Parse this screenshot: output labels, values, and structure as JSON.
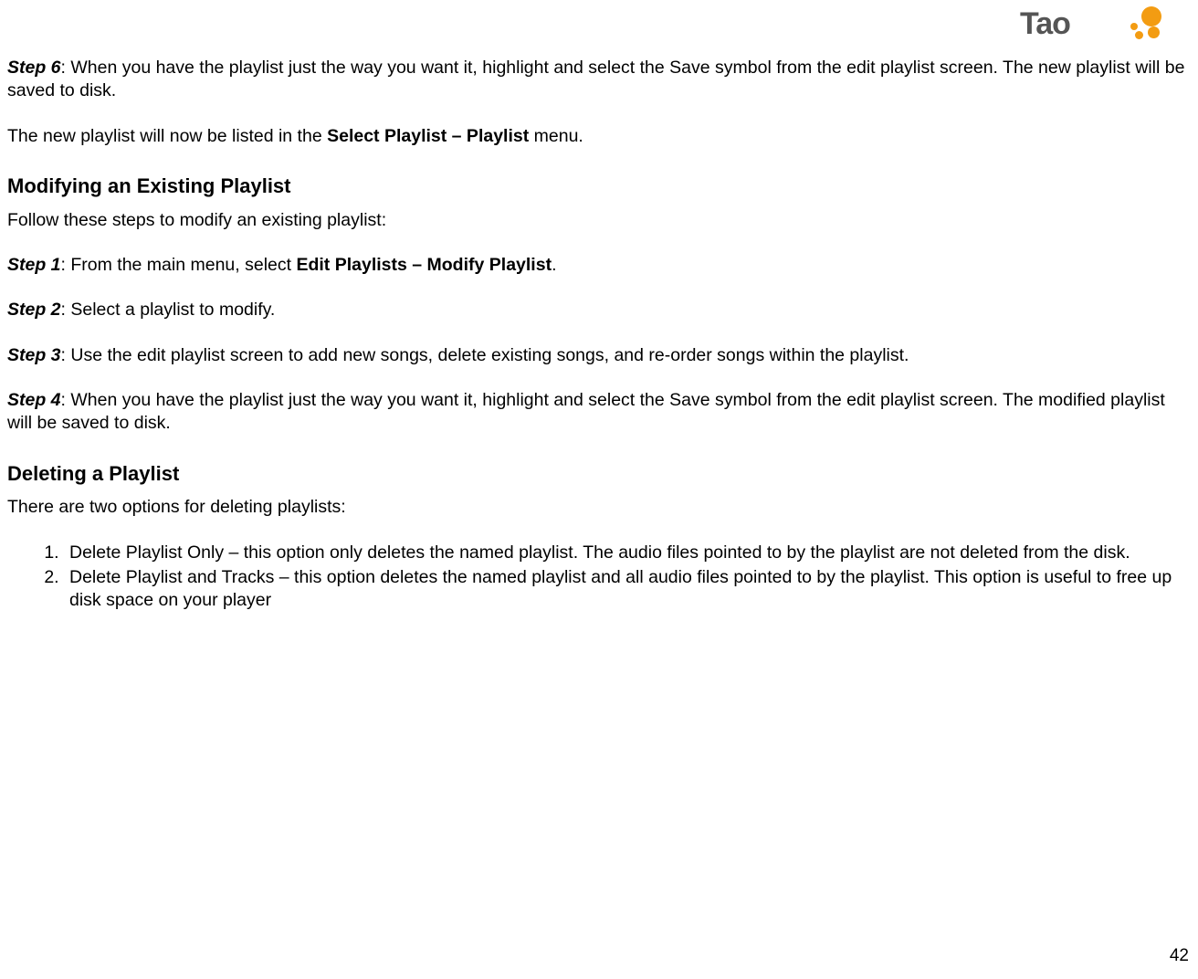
{
  "logo": {
    "text": "Tao"
  },
  "step6": {
    "label": "Step 6",
    "text": ": When you have the playlist just the way you want it, highlight and select the Save symbol from the edit playlist screen.  The new playlist will be saved to disk."
  },
  "newPlaylist": {
    "prefix": "The new playlist will now be listed in the ",
    "bold": "Select Playlist – Playlist",
    "suffix": " menu."
  },
  "modifyHeading": "Modifying an Existing Playlist",
  "modifyIntro": "Follow these steps to modify an existing playlist:",
  "modStep1": {
    "label": "Step 1",
    "prefix": ": From the main menu, select ",
    "bold": "Edit Playlists – Modify Playlist",
    "suffix": "."
  },
  "modStep2": {
    "label": "Step 2",
    "text": ": Select a playlist to modify."
  },
  "modStep3": {
    "label": "Step 3",
    "text": ": Use the edit playlist screen to add new songs, delete existing songs, and re-order songs within the playlist."
  },
  "modStep4": {
    "label": "Step 4",
    "text": ": When you have the playlist just the way you want it, highlight and select the Save symbol from the edit playlist screen.  The modified playlist will be saved to disk."
  },
  "deleteHeading": "Deleting a Playlist",
  "deleteIntro": "There are two options for deleting playlists:",
  "deleteOptions": [
    "Delete Playlist Only – this option only deletes the named playlist.  The audio files pointed to by the playlist are not deleted from the disk.",
    "Delete Playlist and Tracks – this option deletes the named playlist and all audio files pointed to by the playlist.  This option is useful to free up disk space on your player"
  ],
  "pageNumber": "42"
}
